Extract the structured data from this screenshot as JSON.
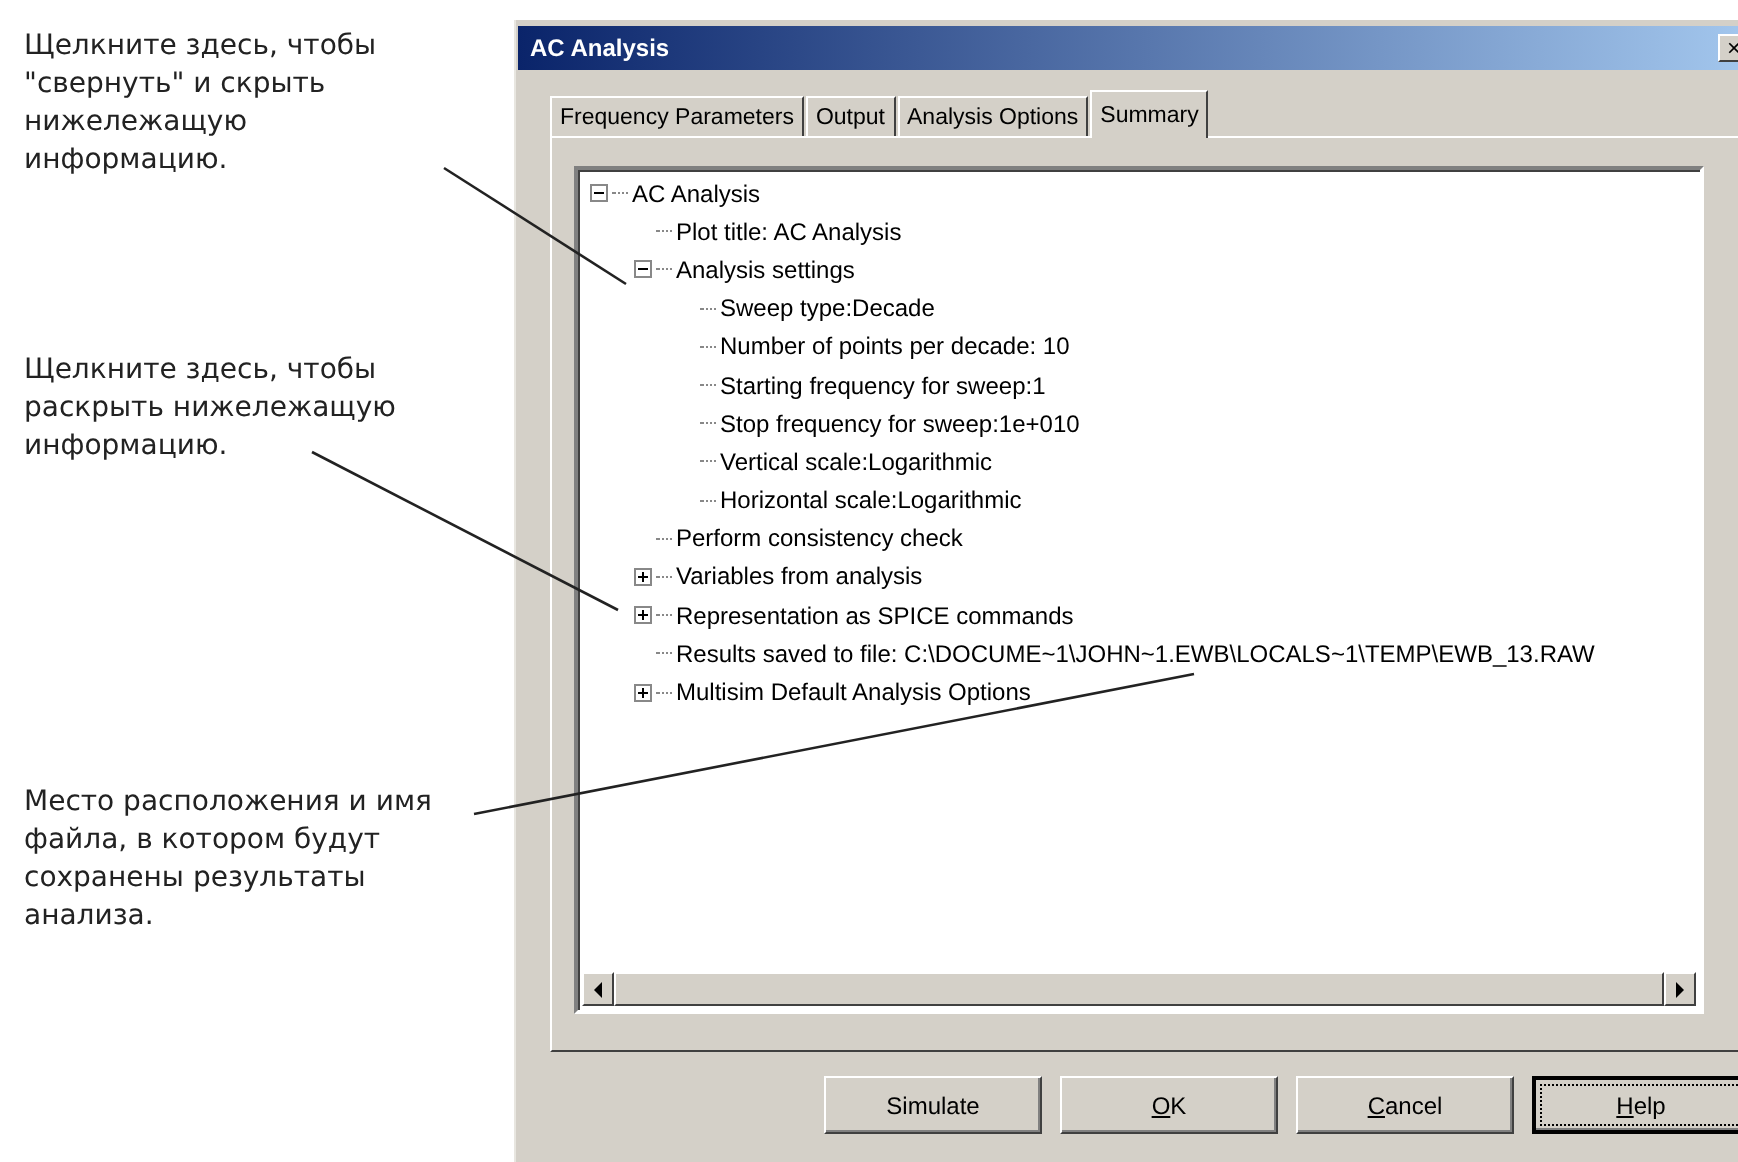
{
  "annotations": [
    {
      "text": "Щелкните здесь, чтобы \"свернуть\" и скрыть нижележащую информацию."
    },
    {
      "text": "Щелкните здесь, чтобы раскрыть нижележащую информацию."
    },
    {
      "text": "Место расположения и имя файла, в котором будут сохранены результаты анализа."
    }
  ],
  "window": {
    "title": "AC Analysis",
    "close": "×"
  },
  "tabs": [
    {
      "label": "Frequency Parameters",
      "selected": false
    },
    {
      "label": "Output",
      "selected": false
    },
    {
      "label": "Analysis Options",
      "selected": false
    },
    {
      "label": "Summary",
      "selected": true
    }
  ],
  "tree": {
    "nodes": [
      {
        "label": "AC Analysis",
        "expanded": true,
        "children": [
          {
            "label": "Plot title: AC Analysis"
          },
          {
            "label": "Analysis settings",
            "expanded": true,
            "children": [
              {
                "label": "Sweep type:Decade"
              },
              {
                "label": "Number of points per decade: 10"
              },
              {
                "label": "Starting frequency for sweep:1"
              },
              {
                "label": "Stop frequency for sweep:1e+010"
              },
              {
                "label": "Vertical scale:Logarithmic"
              },
              {
                "label": "Horizontal scale:Logarithmic"
              }
            ]
          },
          {
            "label": "Perform consistency check"
          },
          {
            "label": "Variables from analysis",
            "expanded": false
          },
          {
            "label": "Representation as SPICE commands",
            "expanded": false
          },
          {
            "label": "Results saved to file: C:\\DOCUME~1\\JOHN~1.EWB\\LOCALS~1\\TEMP\\EWB_13.RAW"
          },
          {
            "label": "Multisim Default Analysis Options",
            "expanded": false
          }
        ]
      }
    ]
  },
  "buttons": [
    {
      "label": "Simulate",
      "underline_first": false,
      "focused": false
    },
    {
      "label": "OK",
      "underline_first": true,
      "focused": false
    },
    {
      "label": "Cancel",
      "underline_first": true,
      "focused": false
    },
    {
      "label": "Help",
      "underline_first": true,
      "focused": true
    }
  ]
}
